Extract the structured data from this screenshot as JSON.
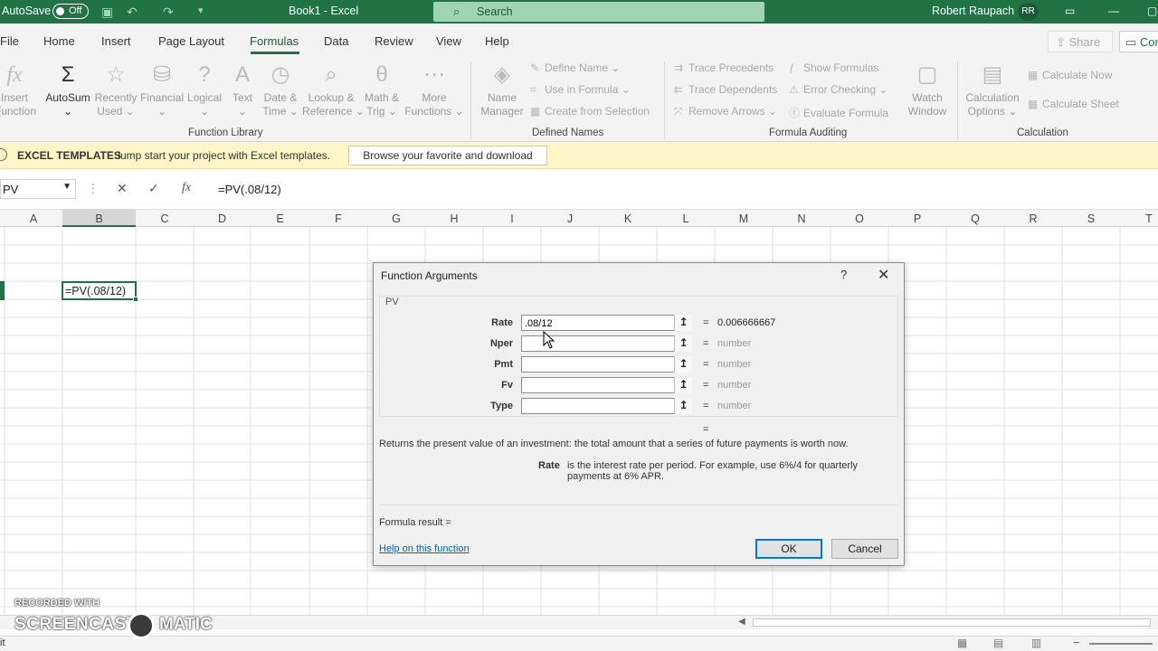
{
  "titlebar": {
    "autosave_label": "AutoSave",
    "autosave_state": "Off",
    "doc_title": "Book1  -  Excel",
    "search_placeholder": "Search",
    "user_name": "Robert Raupach",
    "user_initials": "RR",
    "accent_color": "#217346"
  },
  "menu": {
    "tabs": [
      "File",
      "Home",
      "Insert",
      "Page Layout",
      "Formulas",
      "Data",
      "Review",
      "View",
      "Help"
    ],
    "active_tab": "Formulas",
    "share_label": "Share",
    "comments_label": "Con"
  },
  "ribbon": {
    "function_library": {
      "group_label": "Function Library",
      "insert_function": [
        "Insert",
        "Function"
      ],
      "autosum": "AutoSum",
      "recently_used": [
        "Recently",
        "Used"
      ],
      "financial": "Financial",
      "logical": "Logical",
      "text": "Text",
      "date_time": [
        "Date &",
        "Time"
      ],
      "lookup_reference": [
        "Lookup &",
        "Reference"
      ],
      "math_trig": [
        "Math &",
        "Trig"
      ],
      "more_functions": [
        "More",
        "Functions"
      ]
    },
    "defined_names": {
      "group_label": "Defined Names",
      "name_manager": [
        "Name",
        "Manager"
      ],
      "define_name": "Define Name",
      "use_in_formula": "Use in Formula",
      "create_from_selection": "Create from Selection"
    },
    "formula_auditing": {
      "group_label": "Formula Auditing",
      "trace_precedents": "Trace Precedents",
      "trace_dependents": "Trace Dependents",
      "remove_arrows": "Remove Arrows",
      "show_formulas": "Show Formulas",
      "error_checking": "Error Checking",
      "evaluate_formula": "Evaluate Formula",
      "watch_window": [
        "Watch",
        "Window"
      ]
    },
    "calculation": {
      "group_label": "Calculation",
      "calculation_options": [
        "Calculation",
        "Options"
      ],
      "calculate_now": "Calculate Now",
      "calculate_sheet": "Calculate Sheet"
    }
  },
  "message_bar": {
    "title": "EXCEL TEMPLATES",
    "description": "Jump start your project with Excel templates.",
    "button": "Browse your favorite and download"
  },
  "formula_bar": {
    "name_box": "PV",
    "formula": "=PV(.08/12)"
  },
  "columns": [
    "A",
    "B",
    "C",
    "D",
    "E",
    "F",
    "G",
    "H",
    "I",
    "J",
    "K",
    "L",
    "M",
    "N",
    "O",
    "P",
    "Q",
    "R",
    "S",
    "T"
  ],
  "active_cell": {
    "column": "B",
    "content": "=PV(.08/12)"
  },
  "dialog": {
    "title": "Function Arguments",
    "help_glyph": "?",
    "function_name": "PV",
    "arguments": [
      {
        "label": "Rate",
        "value": ".08/12",
        "result": "0.006666667"
      },
      {
        "label": "Nper",
        "value": "",
        "result": "number"
      },
      {
        "label": "Pmt",
        "value": "",
        "result": "number"
      },
      {
        "label": "Fv",
        "value": "",
        "result": "number"
      },
      {
        "label": "Type",
        "value": "",
        "result": "number"
      }
    ],
    "equals": "=",
    "description": "Returns the present value of an investment: the total amount that a series of future payments is worth now.",
    "arg_desc_name": "Rate",
    "arg_desc_text": "is the interest rate per period. For example, use 6%/4 for quarterly payments at 6% APR.",
    "formula_result_label": "Formula result =",
    "help_link": "Help on this function",
    "ok_label": "OK",
    "cancel_label": "Cancel"
  },
  "watermark": {
    "line1": "RECORDED WITH",
    "line2a": "SCREENCAST",
    "line2b": "MATIC"
  },
  "status": {
    "left_text": "it"
  }
}
